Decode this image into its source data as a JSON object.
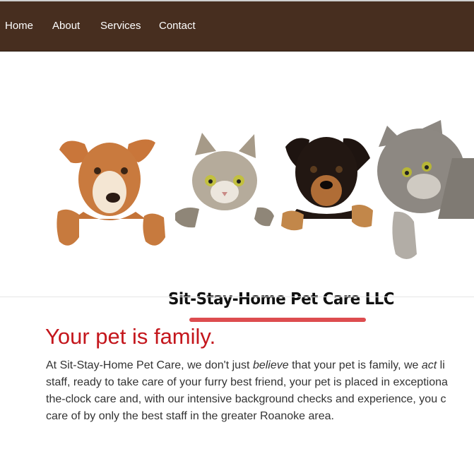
{
  "nav": {
    "items": [
      {
        "label": "Home"
      },
      {
        "label": "About"
      },
      {
        "label": "Services"
      },
      {
        "label": "Contact"
      }
    ]
  },
  "banner": {
    "brand_name": "Sit-Stay-Home Pet Care LLC",
    "pets": [
      "dog-icon",
      "cat-icon",
      "puppy-icon",
      "cat-icon"
    ]
  },
  "main": {
    "headline": "Your pet is family.",
    "lines": [
      {
        "pre": "At Sit-Stay-Home Pet Care, we don't just ",
        "em1": "believe",
        "mid": " that your pet is family, we ",
        "em2": "act",
        "post": " li"
      },
      {
        "text": "staff, ready to take care of your furry best friend, your pet is placed in exceptiona"
      },
      {
        "text": "the-clock care and, with our intensive background checks and experience, you c"
      },
      {
        "text": "care of by only the best staff in the greater Roanoke area."
      }
    ]
  },
  "colors": {
    "nav_bg": "#472e1f",
    "headline": "#c4161c",
    "accent_underline": "#dd4c4f",
    "body_text": "#333333"
  }
}
